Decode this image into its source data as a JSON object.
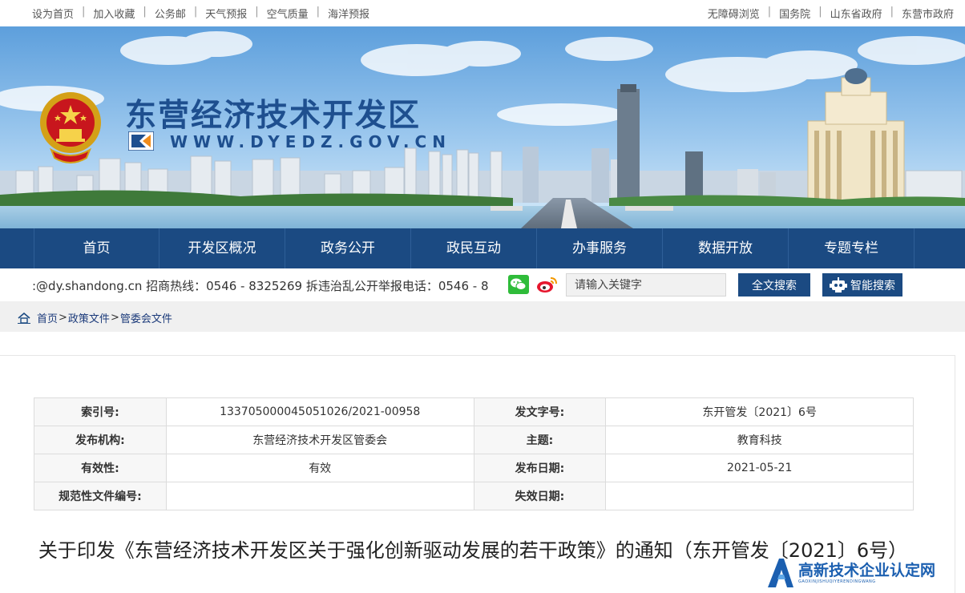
{
  "topbar": {
    "left_links": [
      "设为首页",
      "加入收藏",
      "公务邮",
      "天气预报",
      "空气质量",
      "海洋预报"
    ],
    "right_links": [
      "无障碍浏览",
      "国务院",
      "山东省政府",
      "东营市政府"
    ],
    "separator": "|"
  },
  "banner": {
    "title": "东营经济技术开发区",
    "url": "WWW.DYEDZ.GOV.CN"
  },
  "nav": {
    "items": [
      "首页",
      "开发区概况",
      "政务公开",
      "政民互动",
      "办事服务",
      "数据开放",
      "专题专栏"
    ]
  },
  "inforow": {
    "ticker": ":@dy.shandong.cn 招商热线：0546 - 8325269 拆违治乱公开举报电话：0546 - 8",
    "search_placeholder": "请输入关键字",
    "fulltext_search_label": "全文搜索",
    "smart_search_label": "智能搜索"
  },
  "breadcrumb": {
    "items": [
      "首页",
      "政策文件",
      "管委会文件"
    ],
    "separator": ">"
  },
  "meta_table": {
    "rows": [
      [
        {
          "k": "索引号:",
          "v": "133705000045051026/2021-00958"
        },
        {
          "k": "发文字号:",
          "v": "东开管发〔2021〕6号"
        }
      ],
      [
        {
          "k": "发布机构:",
          "v": "东营经济技术开发区管委会"
        },
        {
          "k": "主题:",
          "v": "教育科技"
        }
      ],
      [
        {
          "k": "有效性:",
          "v": "有效"
        },
        {
          "k": "发布日期:",
          "v": "2021-05-21"
        }
      ],
      [
        {
          "k": "规范性文件编号:",
          "v": ""
        },
        {
          "k": "失效日期:",
          "v": ""
        }
      ]
    ]
  },
  "document": {
    "title": "关于印发《东营经济技术开发区关于强化创新驱动发展的若干政策》的通知（东开管发〔2021〕6号）"
  },
  "watermark": {
    "title": "高新技术企业认定网",
    "subtitle": "GAOXINJISHUQIYERENDINGWANG"
  },
  "colors": {
    "nav_blue": "#1b4a82",
    "title_blue": "#1e4f8f",
    "breadcrumb_bg": "#f0f0f0"
  }
}
